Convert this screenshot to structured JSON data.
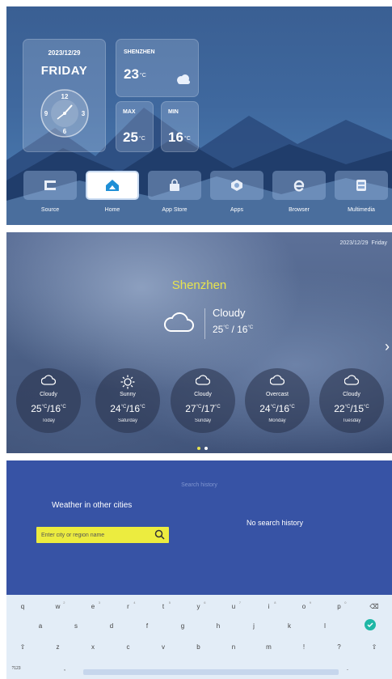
{
  "launcher": {
    "date": "2023/12/29",
    "day": "FRIDAY",
    "clock_numerals": [
      "12",
      "3",
      "6",
      "9"
    ],
    "city": "SHENZHEN",
    "temp": "23",
    "temp_unit": "°C",
    "max_label": "MAX",
    "max_value": "25",
    "min_label": "MIN",
    "min_value": "16",
    "apps": [
      {
        "label": "Source",
        "icon": "source-icon"
      },
      {
        "label": "Home",
        "icon": "home-icon",
        "active": true
      },
      {
        "label": "App Store",
        "icon": "app-store-icon"
      },
      {
        "label": "Apps",
        "icon": "apps-icon"
      },
      {
        "label": "Browser",
        "icon": "browser-icon"
      },
      {
        "label": "Multimedia",
        "icon": "multimedia-icon"
      }
    ]
  },
  "weather": {
    "date": "2023/12/29",
    "weekday": "Friday",
    "city": "Shenzhen",
    "current_condition": "Cloudy",
    "current_high": "25",
    "current_low": "16",
    "unit": "°C",
    "separator": "/",
    "forecast": [
      {
        "condition": "Cloudy",
        "high": "25",
        "low": "16",
        "day": "Today",
        "icon": "cloud-icon"
      },
      {
        "condition": "Sunny",
        "high": "24",
        "low": "16",
        "day": "Saturday",
        "icon": "sun-icon"
      },
      {
        "condition": "Cloudy",
        "high": "27",
        "low": "17",
        "day": "Sunday",
        "icon": "cloud-icon"
      },
      {
        "condition": "Overcast",
        "high": "24",
        "low": "16",
        "day": "Monday",
        "icon": "cloud-icon"
      },
      {
        "condition": "Cloudy",
        "high": "22",
        "low": "15",
        "day": "Tuesday",
        "icon": "cloud-icon"
      }
    ],
    "page_count": 2,
    "current_page": 1,
    "accent_color": "#e7e34f"
  },
  "search": {
    "history_title": "Search history",
    "heading": "Weather in other cities",
    "placeholder": "Enter city or region name",
    "no_history": "No search history"
  },
  "keyboard": {
    "row1": [
      "q",
      "w",
      "e",
      "r",
      "t",
      "y",
      "u",
      "i",
      "o",
      "p",
      "⌫"
    ],
    "row1_hints": [
      "",
      "2",
      "3",
      "4",
      "5",
      "6",
      "7",
      "8",
      "9",
      "0",
      ""
    ],
    "row2": [
      "a",
      "s",
      "d",
      "f",
      "g",
      "h",
      "j",
      "k",
      "l"
    ],
    "row3": [
      "⇧",
      "z",
      "x",
      "c",
      "v",
      "b",
      "n",
      "m",
      "!",
      "?",
      "⇧"
    ],
    "row4_left": "?123",
    "row4_comma": ",",
    "row4_period": "."
  }
}
